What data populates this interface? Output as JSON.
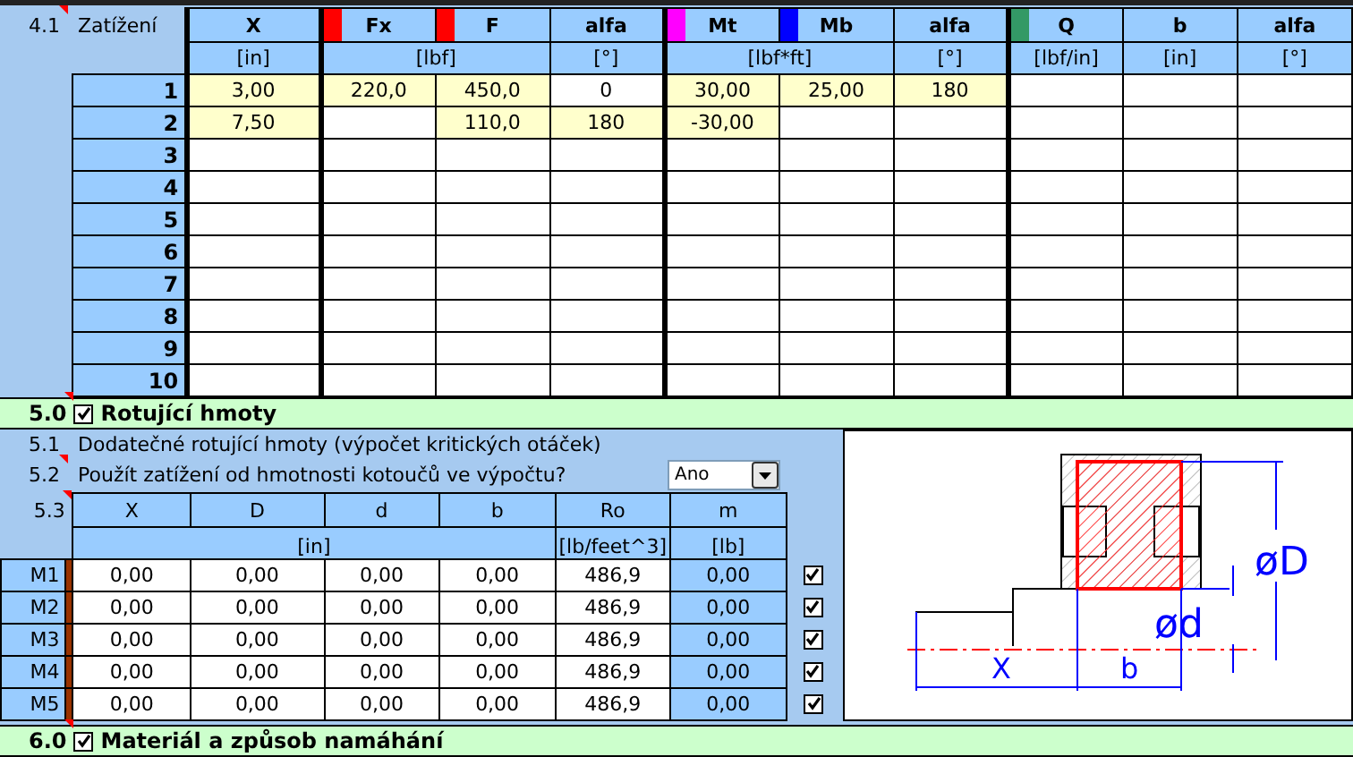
{
  "loads": {
    "number": "4.1",
    "comment": true,
    "label": "Zatížení",
    "groups": [
      {
        "unit": "[in]",
        "columns": [
          {
            "label": "X"
          }
        ]
      },
      {
        "unit": "[lbf]",
        "columns": [
          {
            "label": "Fx",
            "color": "#ff0000"
          },
          {
            "label": "F",
            "color": "#ff0000"
          }
        ]
      },
      {
        "unit": "[°]",
        "columns": [
          {
            "label": "alfa"
          }
        ]
      },
      {
        "unit": "[lbf*ft]",
        "columns": [
          {
            "label": "Mt",
            "color": "#ff00ff"
          },
          {
            "label": "Mb",
            "color": "#0000ff"
          }
        ]
      },
      {
        "unit": "[°]",
        "columns": [
          {
            "label": "alfa"
          }
        ]
      },
      {
        "unit": "[lbf/in]",
        "columns": [
          {
            "label": "Q",
            "color": "#339966"
          }
        ]
      },
      {
        "unit": "[in]",
        "columns": [
          {
            "label": "b"
          }
        ]
      },
      {
        "unit": "[°]",
        "columns": [
          {
            "label": "alfa"
          }
        ]
      }
    ],
    "rows": [
      {
        "label": "1",
        "cells": [
          {
            "value": "3,00",
            "highlighted": true
          },
          {
            "value": "220,0",
            "highlighted": true
          },
          {
            "value": "450,0",
            "highlighted": true
          },
          {
            "value": "0",
            "highlighted": false
          },
          {
            "value": "30,00",
            "highlighted": true
          },
          {
            "value": "25,00",
            "highlighted": true
          },
          {
            "value": "180",
            "highlighted": true
          },
          {
            "highlighted": false
          },
          {
            "highlighted": false
          },
          {
            "highlighted": false
          }
        ]
      },
      {
        "label": "2",
        "cells": [
          {
            "value": "7,50",
            "highlighted": true
          },
          {
            "highlighted": false
          },
          {
            "value": "110,0",
            "highlighted": true
          },
          {
            "value": "180",
            "highlighted": true
          },
          {
            "value": "-30,00",
            "highlighted": true
          },
          {
            "highlighted": false
          },
          {
            "highlighted": false
          },
          {
            "highlighted": false
          },
          {
            "highlighted": false
          },
          {
            "highlighted": false
          }
        ]
      },
      {
        "label": "3"
      },
      {
        "label": "4"
      },
      {
        "label": "5"
      },
      {
        "label": "6"
      },
      {
        "label": "7"
      },
      {
        "label": "8"
      },
      {
        "label": "9"
      },
      {
        "label": "10"
      }
    ]
  },
  "rotating_masses": {
    "number": "5.0",
    "comment": true,
    "checked": true,
    "title": "Rotující hmoty",
    "additional": {
      "number": "5.1",
      "text": "Dodatečné rotující hmoty (výpočet kritických otáček)"
    },
    "use_weight": {
      "number": "5.2",
      "comment": true,
      "text": "Použít zatížení od hmotnosti kotoučů ve výpočtu?",
      "dropdown_value": "Ano"
    },
    "table": {
      "number": "5.3",
      "comment": true,
      "groups": [
        {
          "unit": "[in]",
          "columns": [
            "X",
            "D",
            "d",
            "b"
          ]
        },
        {
          "unit": "[lb/feet^3]",
          "columns": [
            "Ro"
          ]
        },
        {
          "unit": "[lb]",
          "columns": [
            "m"
          ]
        }
      ],
      "rows": [
        {
          "label": "M1",
          "values": [
            "0,00",
            "0,00",
            "0,00",
            "0,00",
            "486,9",
            "0,00"
          ],
          "checked": true
        },
        {
          "label": "M2",
          "values": [
            "0,00",
            "0,00",
            "0,00",
            "0,00",
            "486,9",
            "0,00"
          ],
          "checked": true
        },
        {
          "label": "M3",
          "values": [
            "0,00",
            "0,00",
            "0,00",
            "0,00",
            "486,9",
            "0,00"
          ],
          "checked": true
        },
        {
          "label": "M4",
          "values": [
            "0,00",
            "0,00",
            "0,00",
            "0,00",
            "486,9",
            "0,00"
          ],
          "checked": true
        },
        {
          "label": "M5",
          "values": [
            "0,00",
            "0,00",
            "0,00",
            "0,00",
            "486,9",
            "0,00"
          ],
          "checked": true
        }
      ]
    },
    "diagram": {
      "outer_diameter": "øD",
      "inner_diameter": "ød",
      "position": "X",
      "width": "b"
    }
  },
  "material": {
    "number": "6.0",
    "comment": true,
    "checked": true,
    "title": "Materiál a způsob namáhání"
  }
}
